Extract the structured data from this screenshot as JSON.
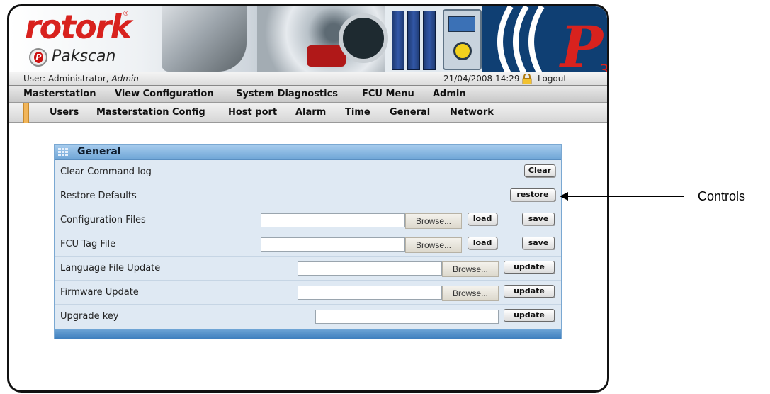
{
  "brand": {
    "logo_text": "rotork",
    "registered_mark": "®",
    "product": "Pakscan",
    "badge_letter": "P"
  },
  "userbar": {
    "user_prefix": "User: Administrator, ",
    "user_role": "Admin",
    "datetime": "21/04/2008 14:29",
    "logout": "Logout"
  },
  "main_menu": [
    "Masterstation",
    "View Configuration",
    "System Diagnostics",
    "FCU Menu",
    "Admin"
  ],
  "sub_menu": [
    "Users",
    "Masterstation Config",
    "Host port",
    "Alarm",
    "Time",
    "General",
    "Network"
  ],
  "panel": {
    "title": "General",
    "rows": [
      {
        "label": "Clear Command log",
        "buttons": [
          "Clear"
        ]
      },
      {
        "label": "Restore Defaults",
        "buttons": [
          "restore"
        ]
      },
      {
        "label": "Configuration Files",
        "browse": "Browse...",
        "buttons": [
          "load",
          "save"
        ]
      },
      {
        "label": "FCU Tag File",
        "browse": "Browse...",
        "buttons": [
          "load",
          "save"
        ]
      },
      {
        "label": "Language File Update",
        "browse": "Browse...",
        "buttons": [
          "update"
        ]
      },
      {
        "label": "Firmware Update",
        "browse": "Browse...",
        "buttons": [
          "update"
        ]
      },
      {
        "label": "Upgrade key",
        "buttons": [
          "update"
        ]
      }
    ]
  },
  "callout": {
    "label": "Controls"
  },
  "colors": {
    "brand_red": "#d8221e",
    "panel_blue": "#6fa5d6",
    "menu_marker": "#f1b55a"
  }
}
